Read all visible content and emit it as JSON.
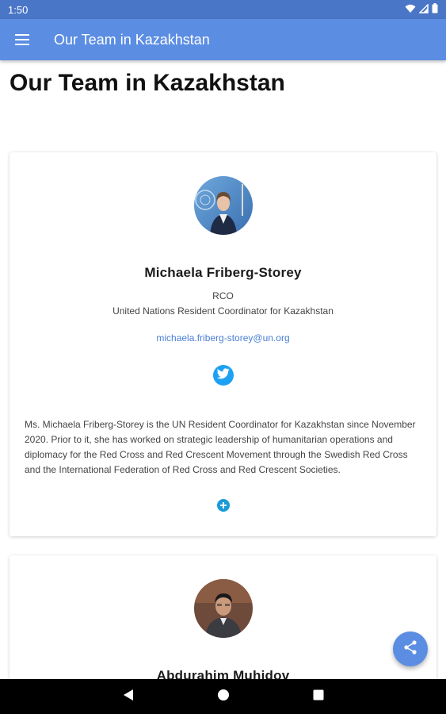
{
  "status_bar": {
    "time": "1:50",
    "icons": [
      "wifi-icon",
      "signal-icon",
      "battery-icon"
    ]
  },
  "app_bar": {
    "title": "Our Team in Kazakhstan",
    "menu_icon": "hamburger-menu-icon"
  },
  "page": {
    "title": "Our Team in Kazakhstan"
  },
  "members": [
    {
      "name": "Michaela Friberg-Storey",
      "role": "RCO",
      "position": "United Nations Resident Coordinator for Kazakhstan",
      "email": "michaela.friberg-storey@un.org",
      "social_icon": "twitter-icon",
      "bio": "Ms. Michaela Friberg-Storey is the UN Resident Coordinator for Kazakhstan since November 2020. Prior to it, she has worked on strategic leadership of humanitarian operations and diplomacy for the Red Cross and Red Crescent Movement through the Swedish Red Cross and the International Federation of Red Cross and Red Crescent Societies.",
      "expand_icon": "plus-circle-icon"
    },
    {
      "name": "Abdurahim Muhidov"
    }
  ],
  "fab": {
    "icon": "share-icon"
  },
  "nav_bar": {
    "icons": [
      "back-icon",
      "home-icon",
      "recents-icon"
    ]
  },
  "colors": {
    "status_bar": "#4a76c7",
    "app_bar": "#5b8de3",
    "link": "#4a7fd6",
    "twitter": "#1da1f2",
    "expand": "#1b9ad8"
  }
}
